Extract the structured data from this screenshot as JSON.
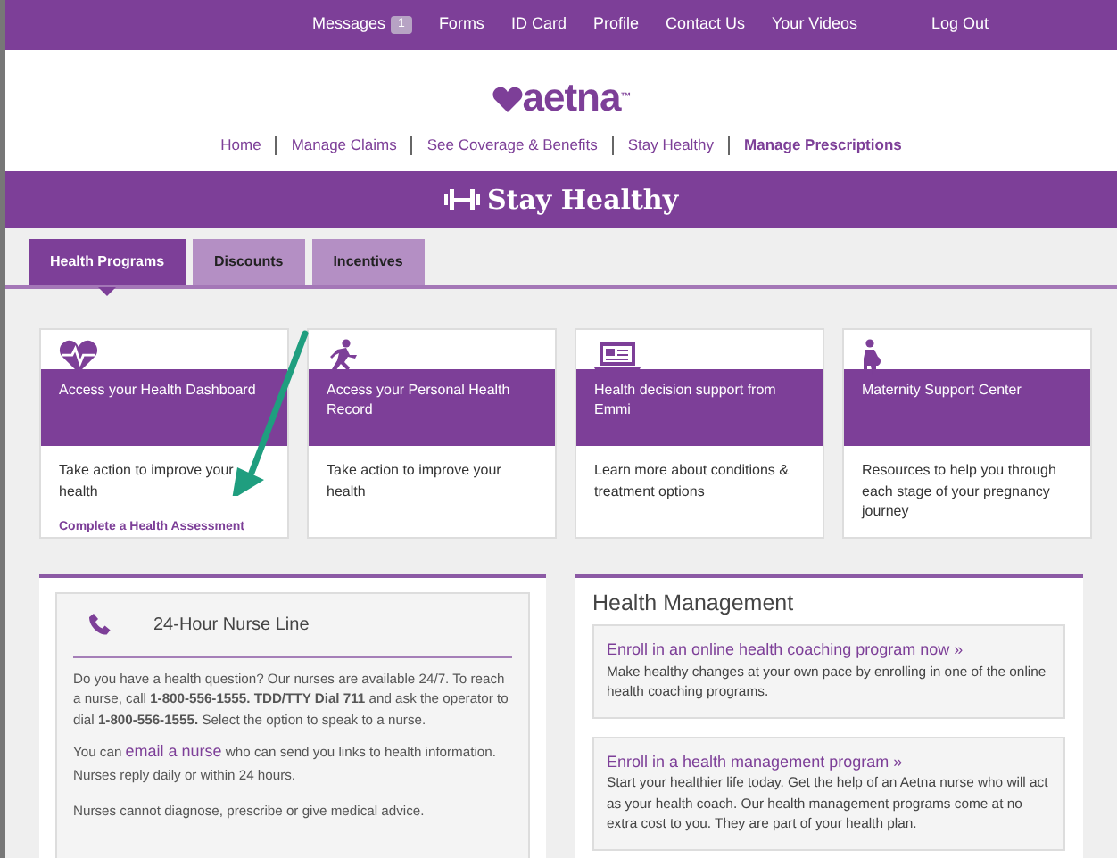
{
  "top_bar": {
    "links": [
      {
        "label": "Messages",
        "badge": "1"
      },
      {
        "label": "Forms"
      },
      {
        "label": "ID Card"
      },
      {
        "label": "Profile"
      },
      {
        "label": "Contact Us"
      },
      {
        "label": "Your Videos"
      }
    ],
    "logout": "Log Out"
  },
  "logo": {
    "text": "aetna",
    "mark": "™"
  },
  "main_nav": [
    {
      "label": "Home",
      "emphasized": false
    },
    {
      "label": "Manage Claims",
      "emphasized": false
    },
    {
      "label": "See Coverage & Benefits",
      "emphasized": false
    },
    {
      "label": "Stay Healthy",
      "emphasized": false
    },
    {
      "label": "Manage Prescriptions",
      "emphasized": true
    }
  ],
  "banner": {
    "title": "Stay Healthy"
  },
  "tabs": [
    {
      "label": "Health Programs",
      "selected": true
    },
    {
      "label": "Discounts",
      "selected": false
    },
    {
      "label": "Incentives",
      "selected": false
    }
  ],
  "program_cards": [
    {
      "title": "Access your Health Dashboard",
      "text": "Take action to improve your health",
      "link": "Complete a Health Assessment"
    },
    {
      "title": "Access your Personal Health Record",
      "text": "Take action to improve your health"
    },
    {
      "title": "Health decision support from Emmi",
      "text": "Learn more about conditions & treatment options"
    },
    {
      "title": "Maternity Support Center",
      "text": "Resources to help you through each stage of your pregnancy journey"
    }
  ],
  "nurse_line": {
    "title": "24-Hour Nurse Line",
    "intro": "Do you have a health question? Our nurses are available 24/7. To reach a nurse, call **1-800-556-1555. TDD/TTY Dial 711** and ask the operator to dial **1-800-556-1555.** Select the option to speak to a nurse.",
    "email_before": "You can ",
    "email_link": "email a nurse",
    "email_after": " who can send you links to health information. Nurses reply daily or within 24 hours.",
    "note": "Nurses cannot diagnose, prescribe or give medical advice."
  },
  "health_management": {
    "title": "Health Management",
    "items": [
      {
        "link": "Enroll in an online health coaching program now »",
        "text": "Make healthy changes at your own pace by enrolling in one of the online health coaching programs."
      },
      {
        "link": "Enroll in a health management program »",
        "text": "Start your healthier life today.  Get the help of an Aetna nurse who will act as your health coach. Our health management programs come at no extra cost to you.  They are part of your health plan."
      }
    ]
  }
}
